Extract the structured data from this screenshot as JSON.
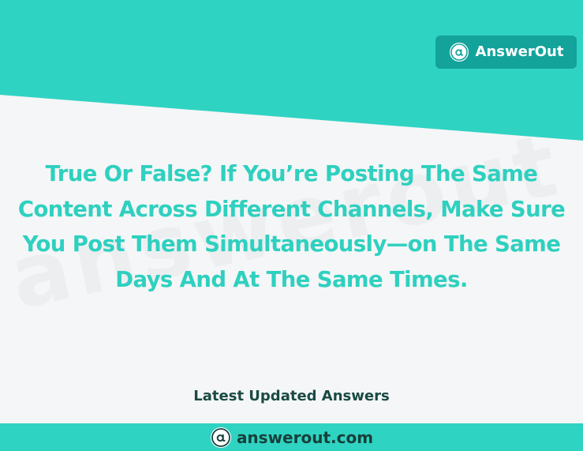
{
  "brand": {
    "name": "AnswerOut",
    "logo_icon": "answerout-at-logo-icon",
    "badge_color": "#13a39b"
  },
  "question": {
    "text": "True Or False? If You’re Posting The Same Content Across Different Channels, Make Sure You Post Them Simultaneously—on The Same Days And At The Same Times."
  },
  "watermark": {
    "text": "answerout"
  },
  "footer": {
    "section_label": "Latest Updated Answers",
    "domain": "answerout.com",
    "logo_icon": "answerout-at-logo-icon"
  },
  "colors": {
    "accent": "#2fd3c2",
    "question_text": "#2fd0bf",
    "dark_text": "#1a4a44",
    "background": "#f5f6f7"
  }
}
